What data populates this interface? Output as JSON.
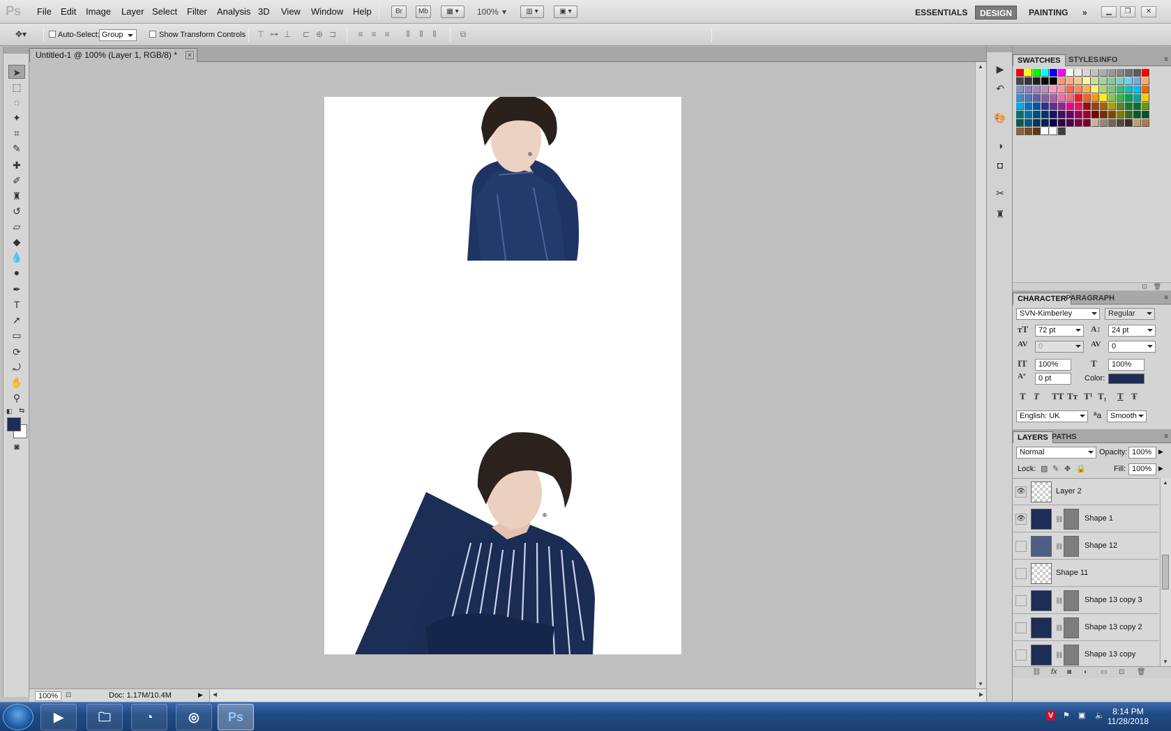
{
  "app": {
    "logo": "Ps",
    "menu": [
      "File",
      "Edit",
      "Image",
      "Layer",
      "Select",
      "Filter",
      "Analysis",
      "3D",
      "View",
      "Window",
      "Help"
    ],
    "bridge": "Br",
    "minibridge": "Mb",
    "zoom": "100%",
    "workspaces": [
      "ESSENTIALS",
      "DESIGN",
      "PAINTING"
    ],
    "active_workspace": "DESIGN",
    "more": "»"
  },
  "options": {
    "auto_select_label": "Auto-Select:",
    "auto_select_value": "Group",
    "transform_label": "Show Transform Controls"
  },
  "document": {
    "tab_title": "Untitled-1 @ 100% (Layer 1, RGB/8) *",
    "zoom": "100%",
    "doc_info": "Doc: 1.17M/10.4M"
  },
  "swatches": {
    "tabs": [
      "SWATCHES",
      "STYLES",
      "INFO"
    ],
    "rows": [
      [
        "#ff0000",
        "#ffff00",
        "#00ff00",
        "#00ffff",
        "#0000ff",
        "#ff00ff",
        "#ffffff",
        "#ebebeb",
        "#d6d6d6",
        "#c2c2c2",
        "#adadad",
        "#999999",
        "#858585",
        "#707070",
        "#5c5c5c",
        "#ff0000"
      ],
      [
        "#474747",
        "#333333",
        "#1f1f1f",
        "#0a0a0a",
        "#000000",
        "#f7977a",
        "#f9ad81",
        "#fdc68a",
        "#fff79a",
        "#c4df9b",
        "#a3d39c",
        "#82ca9d",
        "#7bcdc8",
        "#6ecff6",
        "#7ea7d8",
        "#ffaa66"
      ],
      [
        "#8493ca",
        "#8882be",
        "#a187be",
        "#bc8dbf",
        "#f49ac2",
        "#f6989d",
        "#f26c4f",
        "#f68e55",
        "#fbaf5c",
        "#fff467",
        "#acd372",
        "#7cc576",
        "#3bb878",
        "#1abbb4",
        "#00bff3",
        "#ee6600"
      ],
      [
        "#438ccb",
        "#5574b9",
        "#605ca8",
        "#855fa8",
        "#a763a8",
        "#f06ea9",
        "#f26d7d",
        "#ed1c24",
        "#f26522",
        "#f7941d",
        "#fff200",
        "#8dc63f",
        "#39b54a",
        "#00a651",
        "#00a99d",
        "#ffcc00"
      ],
      [
        "#00aeef",
        "#0072bc",
        "#0054a6",
        "#2e3192",
        "#662d91",
        "#92278f",
        "#ec008c",
        "#ed145b",
        "#9e0b0f",
        "#a0410d",
        "#a36209",
        "#aba000",
        "#598527",
        "#1a7b30",
        "#007236",
        "#669900"
      ],
      [
        "#00746b",
        "#0076a3",
        "#004b80",
        "#003471",
        "#1b1464",
        "#440e62",
        "#630460",
        "#9e005d",
        "#9e0039",
        "#790000",
        "#7b2e00",
        "#7d4900",
        "#827b00",
        "#406618",
        "#005e20",
        "#005826"
      ],
      [
        "#005952",
        "#005b7f",
        "#003663",
        "#002157",
        "#0d004c",
        "#32004b",
        "#4b0049",
        "#7b0046",
        "#7a0026",
        "#c7b299",
        "#998675",
        "#736357",
        "#534741",
        "#37302d",
        "#c69c6d",
        "#a67c52"
      ],
      [
        "#8c6239",
        "#754c24",
        "#603913",
        "#ffffff",
        "#ffffff",
        "#3c3c3c"
      ]
    ]
  },
  "character": {
    "tabs": [
      "CHARACTER",
      "PARAGRAPH"
    ],
    "font_family": "SVN-Kimberley",
    "font_style": "Regular",
    "size": "72 pt",
    "leading": "24 pt",
    "kerning": "0",
    "tracking": "0",
    "vscale": "100%",
    "hscale": "100%",
    "baseline": "0 pt",
    "color_label": "Color:",
    "color": "#1c2d56",
    "style_buttons": [
      "T",
      "T",
      "TT",
      "Tт",
      "T¹",
      "T₁",
      "T",
      "Ŧ"
    ],
    "language": "English: UK",
    "aa_label": "ªa",
    "antialias": "Smooth"
  },
  "layers_panel": {
    "tabs": [
      "LAYERS",
      "PATHS"
    ],
    "blend_mode": "Normal",
    "opacity_label": "Opacity:",
    "opacity": "100%",
    "lock_label": "Lock:",
    "fill_label": "Fill:",
    "fill": "100%",
    "layers": [
      {
        "name": "Layer 2",
        "visible": true,
        "kind": "pixel"
      },
      {
        "name": "Shape 1",
        "visible": true,
        "kind": "shape"
      },
      {
        "name": "Shape 12",
        "visible": false,
        "kind": "shape-mid"
      },
      {
        "name": "Shape 11",
        "visible": false,
        "kind": "pixel"
      },
      {
        "name": "Shape 13 copy 3",
        "visible": false,
        "kind": "shape"
      },
      {
        "name": "Shape 13 copy 2",
        "visible": false,
        "kind": "shape"
      },
      {
        "name": "Shape 13 copy",
        "visible": false,
        "kind": "shape"
      }
    ]
  },
  "taskbar": {
    "apps": [
      "media-player",
      "file-explorer",
      "greenshot",
      "chrome",
      "photoshop"
    ],
    "active_app": "Ps",
    "time": "8:14 PM",
    "date": "11/28/2018"
  }
}
